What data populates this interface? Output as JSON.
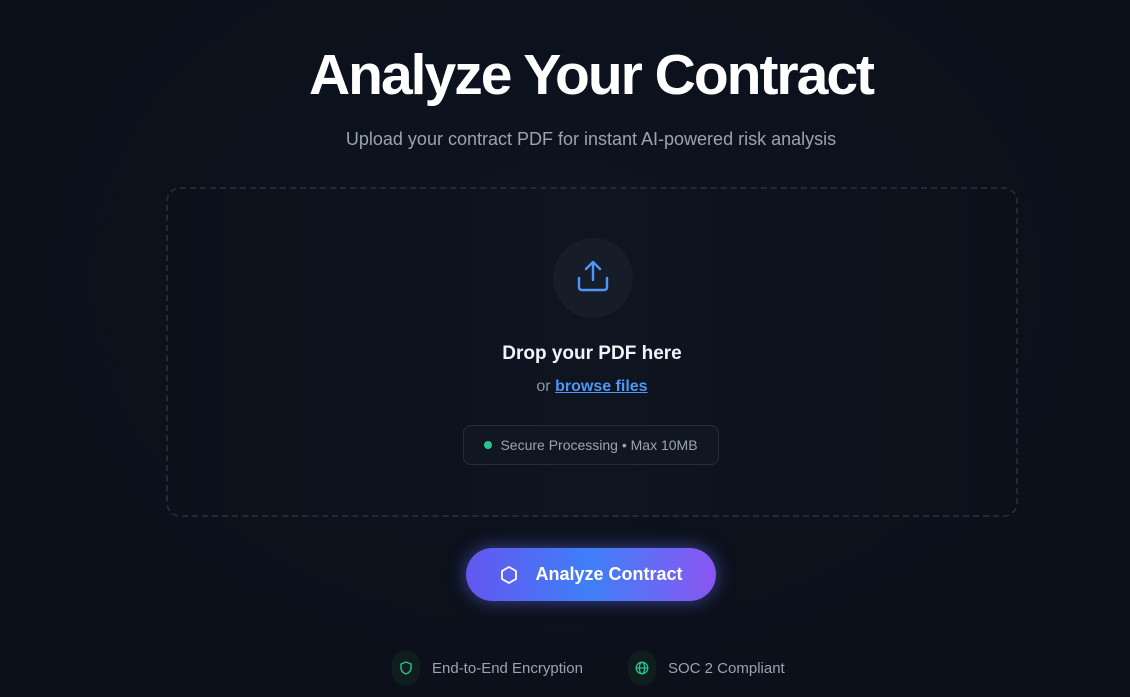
{
  "header": {
    "title": "Analyze Your Contract",
    "subtitle": "Upload your contract PDF for instant AI-powered risk analysis"
  },
  "dropzone": {
    "icon": "upload-icon",
    "title": "Drop your PDF here",
    "or_text": "or",
    "browse_label": "browse files",
    "secure_text": "Secure Processing • Max 10MB"
  },
  "actions": {
    "analyze_label": "Analyze Contract",
    "analyze_icon": "hexagon-icon"
  },
  "badges": [
    {
      "icon": "shield-icon",
      "label": "End-to-End Encryption"
    },
    {
      "icon": "globe-icon",
      "label": "SOC 2 Compliant"
    }
  ],
  "colors": {
    "background": "#0b101b",
    "accent_blue": "#4f97f7",
    "status_green": "#27c48f",
    "button_gradient_start": "#6357f0",
    "button_gradient_end": "#8a56f2"
  }
}
